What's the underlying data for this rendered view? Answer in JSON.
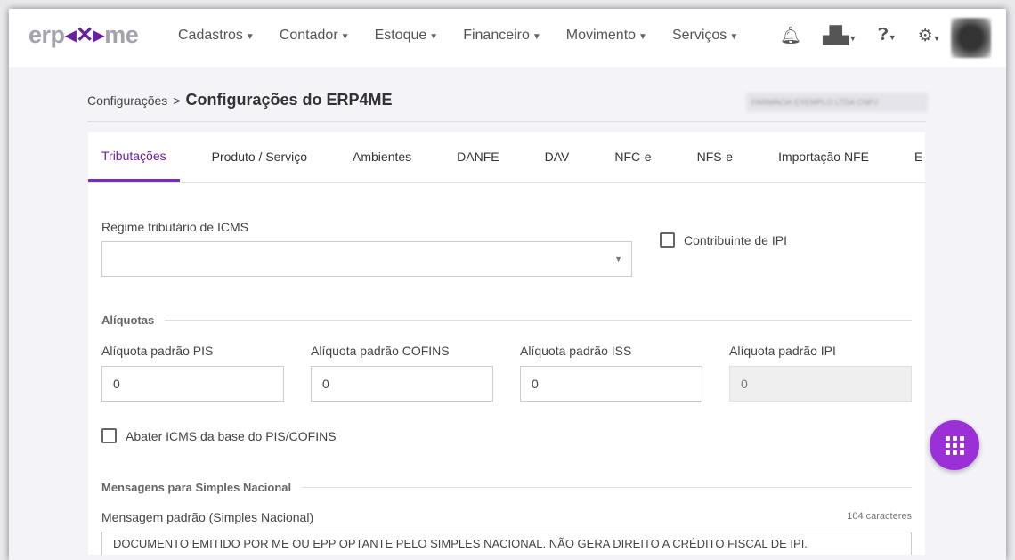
{
  "header": {
    "logo": "erp4me",
    "logo_left": "erp",
    "logo_right": "me",
    "nav": [
      "Cadastros",
      "Contador",
      "Estoque",
      "Financeiro",
      "Movimento",
      "Serviços"
    ]
  },
  "breadcrumb": {
    "parent": "Configurações",
    "separator": ">",
    "title": "Configurações do ERP4ME"
  },
  "company_name_blurred": "FARMÁCIA EXEMPLO LTDA CNPJ",
  "tabs": [
    "Tributações",
    "Produto / Serviço",
    "Ambientes",
    "DANFE",
    "DAV",
    "NFC-e",
    "NFS-e",
    "Importação NFE",
    "E-mail"
  ],
  "form": {
    "regime_label": "Regime tributário de ICMS",
    "regime_value": "",
    "contribuinte_ipi": "Contribuinte de IPI",
    "aliquotas_title": "Alíquotas",
    "pis_label": "Alíquota padrão PIS",
    "pis": "0",
    "cofins_label": "Alíquota padrão COFINS",
    "cofins": "0",
    "iss_label": "Alíquota padrão ISS",
    "iss": "0",
    "ipi_label": "Alíquota padrão IPI",
    "ipi": "0",
    "abater_label": "Abater ICMS da base do PIS/COFINS",
    "mensagens_title": "Mensagens para Simples Nacional",
    "mensagem_label": "Mensagem padrão (Simples Nacional)",
    "mensagem_count": "104 caracteres",
    "mensagem_value": "DOCUMENTO EMITIDO POR ME OU EPP OPTANTE PELO SIMPLES NACIONAL. NÃO GERA DIREITO A CRÉDITO FISCAL DE IPI."
  }
}
